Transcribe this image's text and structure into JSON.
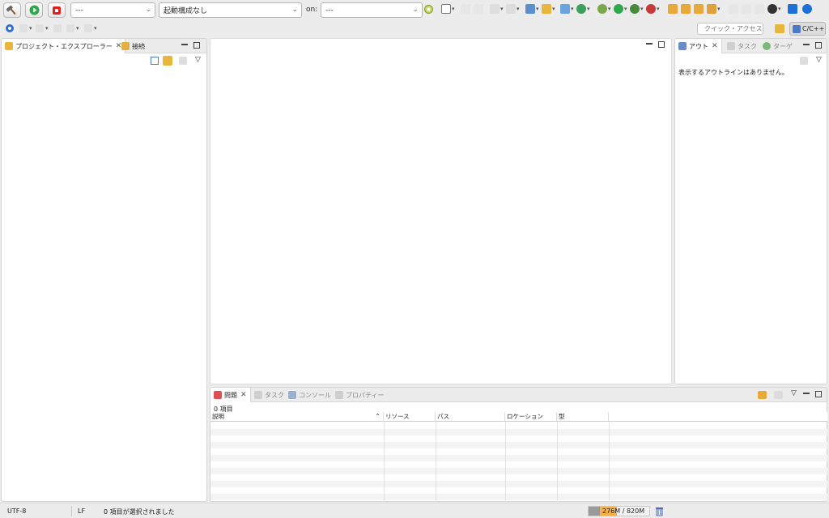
{
  "toolbar": {
    "combo_launch_mode": "---",
    "combo_launch_config": "起動構成なし",
    "on_label": "on:",
    "combo_target": "---"
  },
  "quick_access": {
    "placeholder": "クイック・アクセス"
  },
  "perspective": {
    "label": "C/C++"
  },
  "project_explorer": {
    "tab_project_explorer": "プロジェクト・エクスプローラー",
    "tab_connections": "接続"
  },
  "outline": {
    "tab_outline": "アウト",
    "tab_task": "タスク",
    "tab_target": "ターゲ",
    "empty_message": "表示するアウトラインはありません。"
  },
  "problems": {
    "tab_problems": "問題",
    "tab_task": "タスク",
    "tab_console": "コンソール",
    "tab_properties": "プロパティー",
    "item_count": "0 項目",
    "columns": [
      "説明",
      "リソース",
      "パス",
      "ロケーション",
      "型"
    ]
  },
  "status_bar": {
    "encoding": "UTF-8",
    "line_ending": "LF",
    "selection_text": "0 項目が選択されました",
    "heap_used": 276,
    "heap_total": 820,
    "heap_text": "276M / 820M"
  },
  "colors": {
    "accent_orange": "#f5a623",
    "run_green": "#2ea84a",
    "stop_red": "#e02020",
    "link_blue": "#1f6fd8"
  }
}
